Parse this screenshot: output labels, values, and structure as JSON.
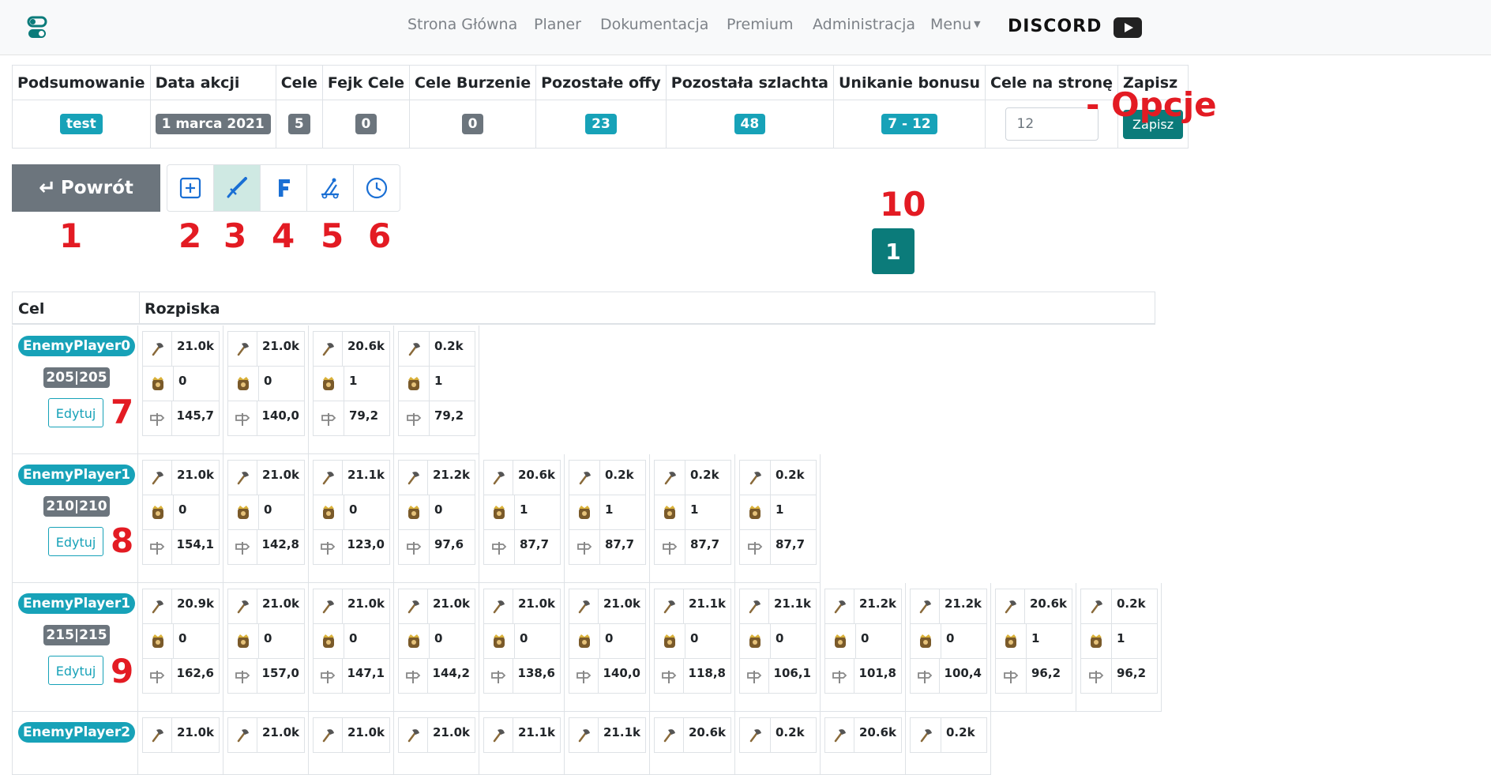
{
  "nav": {
    "items": [
      "Strona Główna",
      "Planer",
      "Dokumentacja",
      "Premium",
      "Administracja",
      "Menu"
    ],
    "discord": "DISCORD"
  },
  "summary": {
    "headers": [
      "Podsumowanie",
      "Data akcji",
      "Cele",
      "Fejk Cele",
      "Cele Burzenie",
      "Pozostałe offy",
      "Pozostała szlachta",
      "Unikanie bonusu",
      "Cele na stronę",
      "Zapisz"
    ],
    "values": [
      "test",
      "1 marca 2021",
      "5",
      "0",
      "0",
      "23",
      "48",
      "7 - 12"
    ],
    "per_page_value": "12",
    "save_label": "Zapisz"
  },
  "annotation_opcje": "- Opcje",
  "back_label": "Powrót",
  "numbers": [
    "1",
    "2",
    "3",
    "4",
    "5",
    "6",
    "7",
    "8",
    "9",
    "10"
  ],
  "page_current": "1",
  "table_head": {
    "cel": "Cel",
    "rozpiska": "Rozpiska"
  },
  "edit_label": "Edytuj",
  "targets": [
    {
      "player": "EnemyPlayer0",
      "coords": "205|205",
      "cards": [
        [
          "21.0k",
          "0",
          "145,7"
        ],
        [
          "21.0k",
          "0",
          "140,0"
        ],
        [
          "20.6k",
          "1",
          "79,2"
        ],
        [
          "0.2k",
          "1",
          "79,2"
        ]
      ]
    },
    {
      "player": "EnemyPlayer1",
      "coords": "210|210",
      "cards": [
        [
          "21.0k",
          "0",
          "154,1"
        ],
        [
          "21.0k",
          "0",
          "142,8"
        ],
        [
          "21.1k",
          "0",
          "123,0"
        ],
        [
          "21.2k",
          "0",
          "97,6"
        ],
        [
          "20.6k",
          "1",
          "87,7"
        ],
        [
          "0.2k",
          "1",
          "87,7"
        ],
        [
          "0.2k",
          "1",
          "87,7"
        ],
        [
          "0.2k",
          "1",
          "87,7"
        ]
      ]
    },
    {
      "player": "EnemyPlayer1",
      "coords": "215|215",
      "cards": [
        [
          "20.9k",
          "0",
          "162,6"
        ],
        [
          "21.0k",
          "0",
          "157,0"
        ],
        [
          "21.0k",
          "0",
          "147,1"
        ],
        [
          "21.0k",
          "0",
          "144,2"
        ],
        [
          "21.0k",
          "0",
          "138,6"
        ],
        [
          "21.0k",
          "0",
          "140,0"
        ],
        [
          "21.1k",
          "0",
          "118,8"
        ],
        [
          "21.1k",
          "0",
          "106,1"
        ],
        [
          "21.2k",
          "0",
          "101,8"
        ],
        [
          "21.2k",
          "0",
          "100,4"
        ],
        [
          "20.6k",
          "1",
          "96,2"
        ],
        [
          "0.2k",
          "1",
          "96,2"
        ]
      ]
    },
    {
      "player": "EnemyPlayer2",
      "coords": "",
      "cards": [
        [
          "21.0k"
        ],
        [
          "21.0k"
        ],
        [
          "21.0k"
        ],
        [
          "21.0k"
        ],
        [
          "21.1k"
        ],
        [
          "21.1k"
        ],
        [
          "20.6k"
        ],
        [
          "0.2k"
        ],
        [
          "20.6k"
        ],
        [
          "0.2k"
        ]
      ]
    }
  ]
}
